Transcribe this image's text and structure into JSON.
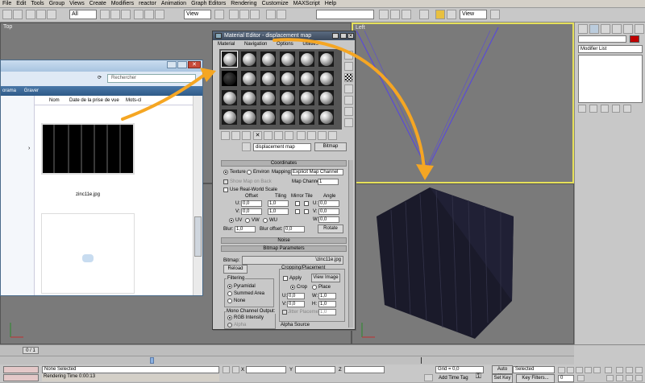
{
  "menu": [
    "File",
    "Edit",
    "Tools",
    "Group",
    "Views",
    "Create",
    "Modifiers",
    "reactor",
    "Animation",
    "Graph Editors",
    "Rendering",
    "Customize",
    "MAXScript",
    "Help"
  ],
  "toolbar": {
    "selection_filter": "All",
    "ref_coord": "View",
    "ref_coord2": "View"
  },
  "viewports": {
    "top_label": "Top",
    "left_label": "Left"
  },
  "command_panel": {
    "modifier_list": "Modifier List"
  },
  "explorer": {
    "search_placeholder": "Rechercher",
    "toolbar_left": "orama",
    "toolbar_burn": "Graver",
    "col_name": "Nom",
    "col_date": "Date de la prise de vue",
    "col_tags": "Mots-cl",
    "file_name": "zinc11e.jpg"
  },
  "material_editor": {
    "title": "Material Editor - displacement map",
    "menu": [
      "Material",
      "Navigation",
      "Options",
      "Utilities"
    ],
    "map_name": "displacement map",
    "map_type": "Bitmap",
    "coordinates": {
      "header": "Coordinates",
      "texture": "Texture",
      "environ": "Environ",
      "mapping_label": "Mapping:",
      "mapping_value": "Explicit Map Channel",
      "show_map_on_back": "Show Map on Back",
      "map_channel_label": "Map Channel:",
      "map_channel_value": "1",
      "use_real_world": "Use Real-World Scale",
      "offset": "Offset",
      "tiling": "Tiling",
      "mirror_tile": "Mirror Tile",
      "angle": "Angle",
      "u_label": "U:",
      "v_label": "V:",
      "w_label": "W:",
      "u_offset": "0,0",
      "v_offset": "0,0",
      "u_tiling": "1,0",
      "v_tiling": "1,0",
      "u_angle": "0,0",
      "v_angle": "0,0",
      "w_angle": "0,0",
      "uv": "UV",
      "vw": "VW",
      "wu": "WU",
      "blur_label": "Blur:",
      "blur_value": "1,0",
      "blur_offset_label": "Blur offset:",
      "blur_offset_value": "0,0",
      "rotate": "Rotate"
    },
    "noise_header": "Noise",
    "bitmap_params": {
      "header": "Bitmap Parameters",
      "bitmap_label": "Bitmap:",
      "bitmap_path": "\\zinc11e.jpg",
      "reload": "Reload",
      "cropping": "Cropping/Placement",
      "apply": "Apply",
      "view_image": "View Image",
      "crop": "Crop",
      "place": "Place",
      "u_label": "U:",
      "v_label": "V:",
      "w_label": "W:",
      "h_label": "H:",
      "u": "0,0",
      "v": "0,0",
      "w": "1,0",
      "h": "1,0",
      "jitter": "Jitter Placement:",
      "jitter_value": "1,0",
      "filtering": "Filtering",
      "pyramidal": "Pyramidal",
      "summed_area": "Summed Area",
      "none": "None",
      "mono_output": "Mono Channel Output:",
      "rgb_intensity": "RGB Intensity",
      "alpha": "Alpha",
      "alpha_source": "Alpha Source"
    }
  },
  "status": {
    "frame": "0 / 1",
    "none_selected": "None Selected",
    "rendering_time": "Rendering Time  0:00:13",
    "x_label": "X",
    "y_label": "Y",
    "z_label": "Z",
    "grid": "Grid = 0,0",
    "add_time_tag": "Add Time Tag",
    "auto_key": "Auto Key",
    "selected": "Selected",
    "set_key": "Set Key",
    "key_filters": "Key Filters...",
    "frame_spinner": "0"
  },
  "colors": {
    "arrow": "#f5a623",
    "viewport_active": "#e6e05a",
    "wire": "#5a4bd6",
    "box": "#1a1a2a"
  }
}
